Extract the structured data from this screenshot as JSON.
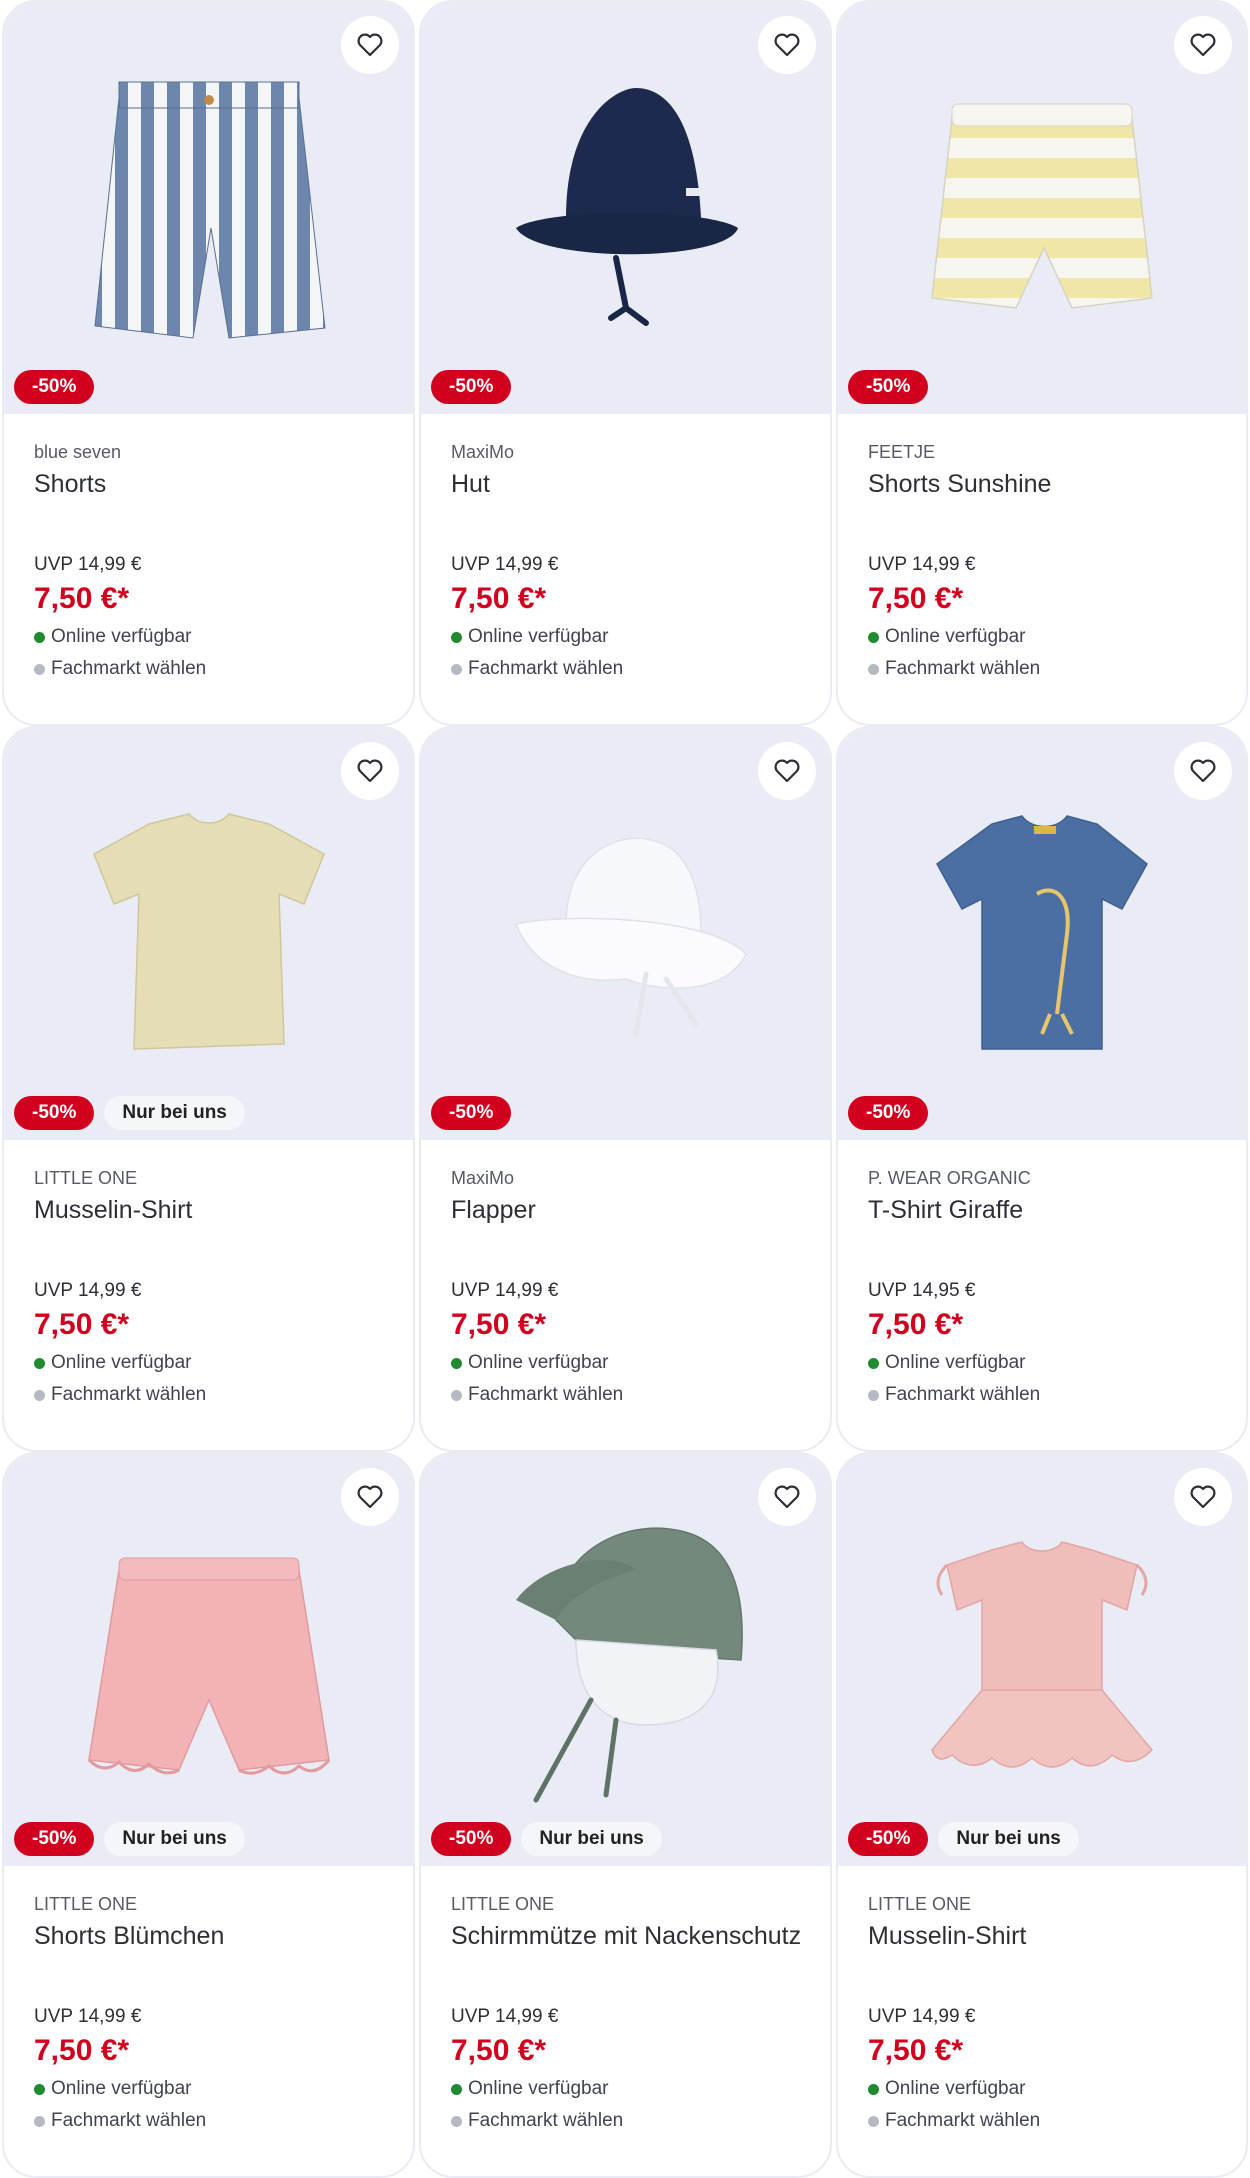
{
  "colors": {
    "accent": "#d1001f",
    "available": "#1f8a2f",
    "image_bg": "#e9ecf4"
  },
  "products": [
    {
      "brand": "blue seven",
      "name": "Shorts",
      "uvp": "UVP 14,99 €",
      "price": "7,50 €*",
      "discount": "-50%",
      "exclusive": "",
      "availability": "Online verfügbar",
      "store": "Fachmarkt wählen",
      "image_icon": "striped-shorts-image"
    },
    {
      "brand": "MaxiMo",
      "name": "Hut",
      "uvp": "UVP 14,99 €",
      "price": "7,50 €*",
      "discount": "-50%",
      "exclusive": "",
      "availability": "Online verfügbar",
      "store": "Fachmarkt wählen",
      "image_icon": "navy-bucket-hat-image"
    },
    {
      "brand": "FEETJE",
      "name": "Shorts Sunshine",
      "uvp": "UVP 14,99 €",
      "price": "7,50 €*",
      "discount": "-50%",
      "exclusive": "",
      "availability": "Online verfügbar",
      "store": "Fachmarkt wählen",
      "image_icon": "yellow-striped-shorts-image"
    },
    {
      "brand": "LITTLE ONE",
      "name": "Musselin-Shirt",
      "uvp": "UVP 14,99 €",
      "price": "7,50 €*",
      "discount": "-50%",
      "exclusive": "Nur bei uns",
      "availability": "Online verfügbar",
      "store": "Fachmarkt wählen",
      "image_icon": "beige-shirt-image"
    },
    {
      "brand": "MaxiMo",
      "name": "Flapper",
      "uvp": "UVP 14,99 €",
      "price": "7,50 €*",
      "discount": "-50%",
      "exclusive": "",
      "availability": "Online verfügbar",
      "store": "Fachmarkt wählen",
      "image_icon": "white-sun-hat-image"
    },
    {
      "brand": "P. WEAR ORGANIC",
      "name": "T-Shirt Giraffe",
      "uvp": "UVP 14,95 €",
      "price": "7,50 €*",
      "discount": "-50%",
      "exclusive": "",
      "availability": "Online verfügbar",
      "store": "Fachmarkt wählen",
      "image_icon": "blue-giraffe-tshirt-image"
    },
    {
      "brand": "LITTLE ONE",
      "name": "Shorts Blümchen",
      "uvp": "UVP 14,99 €",
      "price": "7,50 €*",
      "discount": "-50%",
      "exclusive": "Nur bei uns",
      "availability": "Online verfügbar",
      "store": "Fachmarkt wählen",
      "image_icon": "pink-floral-shorts-image"
    },
    {
      "brand": "LITTLE ONE",
      "name": "Schirmmütze mit Nackenschutz",
      "uvp": "UVP 14,99 €",
      "price": "7,50 €*",
      "discount": "-50%",
      "exclusive": "Nur bei uns",
      "availability": "Online verfügbar",
      "store": "Fachmarkt wählen",
      "image_icon": "green-cap-neck-guard-image"
    },
    {
      "brand": "LITTLE ONE",
      "name": "Musselin-Shirt",
      "uvp": "UVP 14,99 €",
      "price": "7,50 €*",
      "discount": "-50%",
      "exclusive": "Nur bei uns",
      "availability": "Online verfügbar",
      "store": "Fachmarkt wählen",
      "image_icon": "pink-ruffle-shirt-image"
    }
  ]
}
